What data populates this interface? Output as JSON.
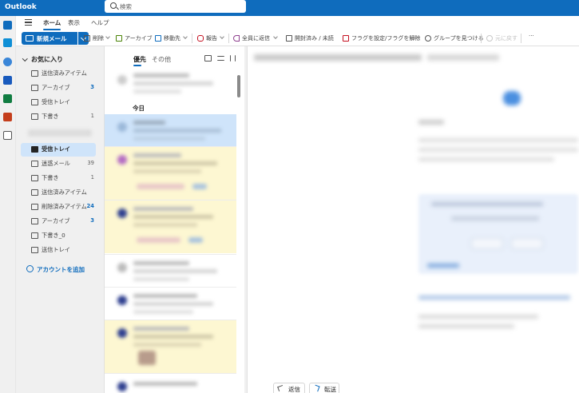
{
  "app": {
    "title": "Outlook"
  },
  "search": {
    "placeholder": "検索"
  },
  "nav": {
    "tabs": [
      {
        "label": "ホーム"
      },
      {
        "label": "表示"
      },
      {
        "label": "ヘルプ"
      }
    ]
  },
  "ribbon": {
    "new_mail": "新規メール",
    "delete": "削除",
    "archive": "アーカイブ",
    "move": "移動先",
    "report": "報告",
    "reply_all": "全員に返信",
    "read_unread": "開封済み / 未読",
    "flag": "フラグを設定/フラグを解除",
    "find_groups": "グループを見つける",
    "undo": "元に戻す",
    "more": "···"
  },
  "favorites": {
    "header": "お気に入り",
    "items": [
      {
        "label": "送信済みアイテム",
        "count": ""
      },
      {
        "label": "アーカイブ",
        "count": "3"
      },
      {
        "label": "受信トレイ",
        "count": ""
      },
      {
        "label": "下書き",
        "count": "1"
      }
    ]
  },
  "account_folders": {
    "items": [
      {
        "label": "受信トレイ",
        "count": ""
      },
      {
        "label": "迷惑メール",
        "count": "39"
      },
      {
        "label": "下書き",
        "count": "1"
      },
      {
        "label": "送信済みアイテム",
        "count": ""
      },
      {
        "label": "削除済みアイテム",
        "count": "24"
      },
      {
        "label": "アーカイブ",
        "count": "3"
      },
      {
        "label": "下書き_0",
        "count": ""
      },
      {
        "label": "送信トレイ",
        "count": ""
      }
    ]
  },
  "add_account": "アカウントを追加",
  "message_list": {
    "tabs": [
      {
        "label": "優先"
      },
      {
        "label": "その他"
      }
    ],
    "group_today": "今日"
  },
  "reading_pane": {
    "reply_button": "返信",
    "forward_button": "転送"
  },
  "colors": {
    "accent": "#0f6cbd",
    "selected_bg": "#cfe4fa",
    "unread_bg": "#fdf7d2"
  }
}
